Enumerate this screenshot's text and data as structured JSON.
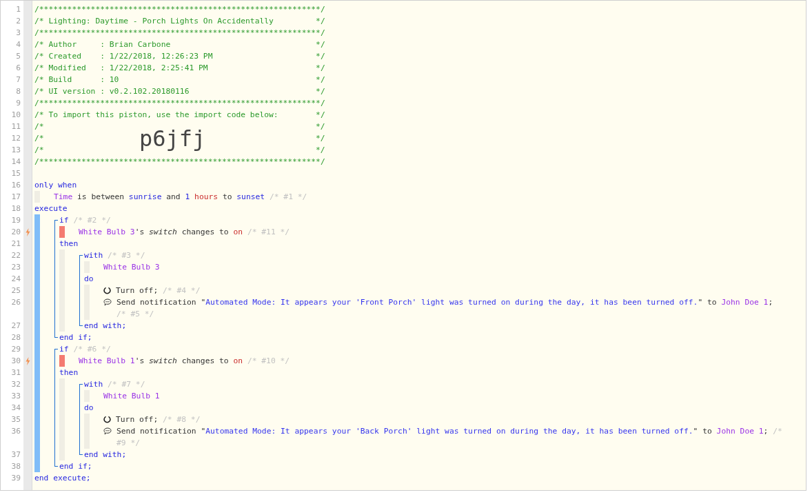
{
  "editor": {
    "banner": [
      {
        "number": "1",
        "text": "/************************************************************/"
      },
      {
        "number": "2",
        "text": "/* Lighting: Daytime - Porch Lights On Accidentally         */"
      },
      {
        "number": "3",
        "text": "/************************************************************/"
      },
      {
        "number": "4",
        "text": "/* Author     : Brian Carbone                               */"
      },
      {
        "number": "5",
        "text": "/* Created    : 1/22/2018, 12:26:23 PM                      */"
      },
      {
        "number": "6",
        "text": "/* Modified   : 1/22/2018, 2:25:41 PM                       */"
      },
      {
        "number": "7",
        "text": "/* Build      : 10                                          */"
      },
      {
        "number": "8",
        "text": "/* UI version : v0.2.102.20180116                           */"
      },
      {
        "number": "9",
        "text": "/************************************************************/"
      },
      {
        "number": "10",
        "text": "/* To import this piston, use the import code below:        */"
      },
      {
        "number": "11",
        "left": "/*",
        "right": "*/"
      },
      {
        "number": "12",
        "left": "/*",
        "right": "*/",
        "import_code": "p6jfj"
      },
      {
        "number": "13",
        "left": "/*",
        "right": "*/"
      },
      {
        "number": "14",
        "text": "/************************************************************/"
      },
      {
        "number": "15"
      }
    ],
    "code": [
      {
        "kind": "group",
        "number": "16",
        "tokens": [
          {
            "kind": "keyword",
            "text": "only when"
          }
        ],
        "children": [
          {
            "kind": "line",
            "number": "17",
            "trigger": false,
            "tokens": [
              {
                "kind": "device",
                "text": "Time"
              },
              {
                "kind": "text",
                "text": " is between "
              },
              {
                "kind": "keyword",
                "text": "sunrise"
              },
              {
                "kind": "text",
                "text": " and "
              },
              {
                "kind": "keyword",
                "text": "1"
              },
              {
                "kind": "value",
                "text": " hours"
              },
              {
                "kind": "text",
                "text": " to "
              },
              {
                "kind": "keyword",
                "text": "sunset"
              },
              {
                "kind": "comment",
                "text": " /* #1 */"
              }
            ]
          }
        ]
      },
      {
        "kind": "execute",
        "number": "18",
        "tokens": [
          {
            "kind": "keyword",
            "text": "execute"
          }
        ],
        "children": [
          {
            "kind": "bracket",
            "children": [
              {
                "kind": "group",
                "number": "19",
                "tokens": [
                  {
                    "kind": "keyword",
                    "text": "if"
                  },
                  {
                    "kind": "comment",
                    "text": " /* #2 */"
                  }
                ],
                "children": [
                  {
                    "kind": "line",
                    "number": "20",
                    "trigger": true,
                    "tokens": [
                      {
                        "kind": "device",
                        "text": "White Bulb 3"
                      },
                      {
                        "kind": "text",
                        "text": "'s "
                      },
                      {
                        "kind": "emphasis",
                        "text": "switch"
                      },
                      {
                        "kind": "text",
                        "text": " changes to "
                      },
                      {
                        "kind": "value",
                        "text": "on"
                      },
                      {
                        "kind": "comment",
                        "text": " /* #11 */"
                      }
                    ]
                  }
                ]
              },
              {
                "kind": "group",
                "number": "21",
                "tokens": [
                  {
                    "kind": "keyword",
                    "text": "then"
                  }
                ],
                "children": [
                  {
                    "kind": "bracket",
                    "children": [
                      {
                        "kind": "group",
                        "number": "22",
                        "tokens": [
                          {
                            "kind": "keyword",
                            "text": "with"
                          },
                          {
                            "kind": "comment",
                            "text": " /* #3 */"
                          }
                        ],
                        "children": [
                          {
                            "kind": "line",
                            "number": "23",
                            "trigger": false,
                            "tokens": [
                              {
                                "kind": "device",
                                "text": "White Bulb 3"
                              }
                            ]
                          }
                        ]
                      },
                      {
                        "kind": "group",
                        "number": "24",
                        "tokens": [
                          {
                            "kind": "keyword",
                            "text": "do"
                          }
                        ],
                        "children": [
                          {
                            "kind": "line",
                            "number": "25",
                            "trigger": false,
                            "tokens": [
                              {
                                "kind": "off_icon"
                              },
                              {
                                "kind": "text",
                                "text": "Turn off;"
                              },
                              {
                                "kind": "comment",
                                "text": " /* #4 */"
                              }
                            ]
                          },
                          {
                            "kind": "line",
                            "number": "26",
                            "trigger": false,
                            "tokens": [
                              {
                                "kind": "message_icon"
                              },
                              {
                                "kind": "text",
                                "text": "Send notification \""
                              },
                              {
                                "kind": "string",
                                "text": "Automated Mode: It appears your 'Front Porch' light was turned on during the day, it has been turned off."
                              },
                              {
                                "kind": "text",
                                "text": "\" to "
                              },
                              {
                                "kind": "device",
                                "text": "John Doe 1"
                              },
                              {
                                "kind": "text",
                                "text": "; "
                              },
                              {
                                "kind": "comment",
                                "text": "/* #5 */"
                              }
                            ]
                          }
                        ]
                      },
                      {
                        "kind": "line",
                        "number": "27",
                        "tokens": [
                          {
                            "kind": "keyword",
                            "text": "end with;"
                          }
                        ]
                      }
                    ]
                  }
                ]
              },
              {
                "kind": "line",
                "number": "28",
                "tokens": [
                  {
                    "kind": "keyword",
                    "text": "end if;"
                  }
                ]
              }
            ]
          },
          {
            "kind": "bracket",
            "children": [
              {
                "kind": "group",
                "number": "29",
                "tokens": [
                  {
                    "kind": "keyword",
                    "text": "if"
                  },
                  {
                    "kind": "comment",
                    "text": " /* #6 */"
                  }
                ],
                "children": [
                  {
                    "kind": "line",
                    "number": "30",
                    "trigger": true,
                    "tokens": [
                      {
                        "kind": "device",
                        "text": "White Bulb 1"
                      },
                      {
                        "kind": "text",
                        "text": "'s "
                      },
                      {
                        "kind": "emphasis",
                        "text": "switch"
                      },
                      {
                        "kind": "text",
                        "text": " changes to "
                      },
                      {
                        "kind": "value",
                        "text": "on"
                      },
                      {
                        "kind": "comment",
                        "text": " /* #10 */"
                      }
                    ]
                  }
                ]
              },
              {
                "kind": "group",
                "number": "31",
                "tokens": [
                  {
                    "kind": "keyword",
                    "text": "then"
                  }
                ],
                "children": [
                  {
                    "kind": "bracket",
                    "children": [
                      {
                        "kind": "group",
                        "number": "32",
                        "tokens": [
                          {
                            "kind": "keyword",
                            "text": "with"
                          },
                          {
                            "kind": "comment",
                            "text": " /* #7 */"
                          }
                        ],
                        "children": [
                          {
                            "kind": "line",
                            "number": "33",
                            "trigger": false,
                            "tokens": [
                              {
                                "kind": "device",
                                "text": "White Bulb 1"
                              }
                            ]
                          }
                        ]
                      },
                      {
                        "kind": "group",
                        "number": "34",
                        "tokens": [
                          {
                            "kind": "keyword",
                            "text": "do"
                          }
                        ],
                        "children": [
                          {
                            "kind": "line",
                            "number": "35",
                            "trigger": false,
                            "tokens": [
                              {
                                "kind": "off_icon"
                              },
                              {
                                "kind": "text",
                                "text": "Turn off;"
                              },
                              {
                                "kind": "comment",
                                "text": " /* #8 */"
                              }
                            ]
                          },
                          {
                            "kind": "line",
                            "number": "36",
                            "trigger": false,
                            "tokens": [
                              {
                                "kind": "message_icon"
                              },
                              {
                                "kind": "text",
                                "text": "Send notification \""
                              },
                              {
                                "kind": "string",
                                "text": "Automated Mode: It appears your 'Back Porch' light was turned on during the day, it has been turned off."
                              },
                              {
                                "kind": "text",
                                "text": "\" to "
                              },
                              {
                                "kind": "device",
                                "text": "John Doe 1"
                              },
                              {
                                "kind": "text",
                                "text": "; "
                              },
                              {
                                "kind": "comment",
                                "text": "/* #9 */"
                              }
                            ]
                          }
                        ]
                      },
                      {
                        "kind": "line",
                        "number": "37",
                        "tokens": [
                          {
                            "kind": "keyword",
                            "text": "end with;"
                          }
                        ]
                      }
                    ]
                  }
                ]
              },
              {
                "kind": "line",
                "number": "38",
                "tokens": [
                  {
                    "kind": "keyword",
                    "text": "end if;"
                  }
                ]
              }
            ]
          }
        ]
      },
      {
        "kind": "line",
        "number": "39",
        "tokens": [
          {
            "kind": "keyword",
            "text": "end execute;"
          }
        ]
      }
    ]
  }
}
